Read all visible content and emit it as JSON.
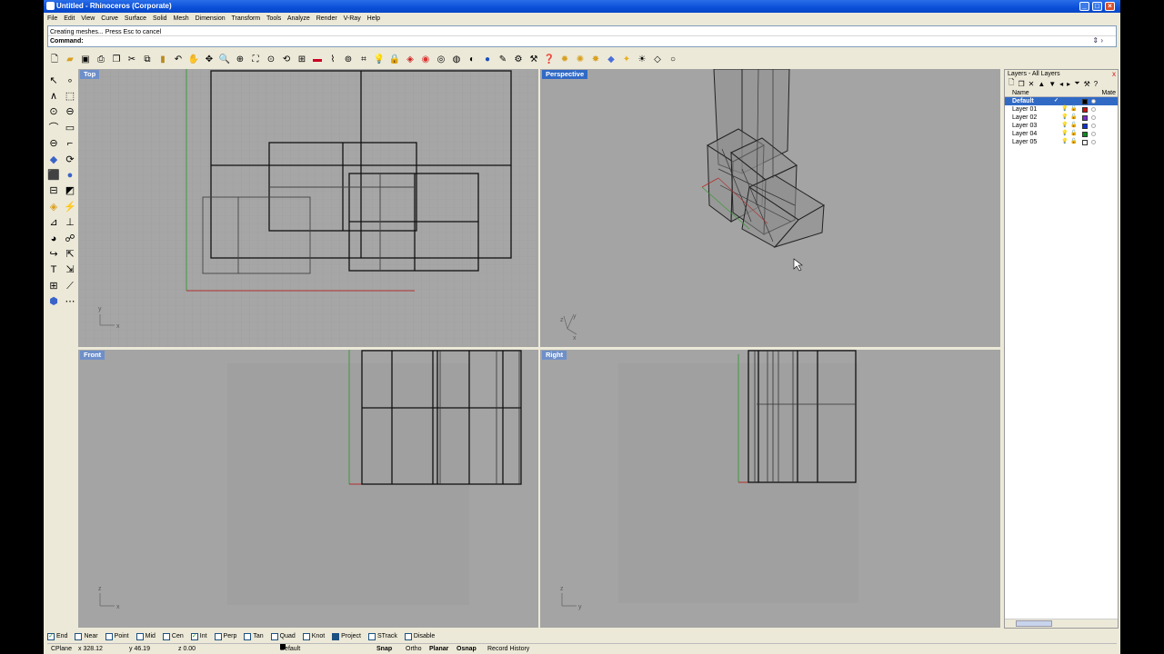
{
  "window": {
    "title": "Untitled - Rhinoceros (Corporate)"
  },
  "menu": [
    "File",
    "Edit",
    "View",
    "Curve",
    "Surface",
    "Solid",
    "Mesh",
    "Dimension",
    "Transform",
    "Tools",
    "Analyze",
    "Render",
    "V-Ray",
    "Help"
  ],
  "command": {
    "history": "Creating meshes... Press Esc to cancel",
    "prompt": "Command:"
  },
  "viewports": {
    "top": "Top",
    "perspective": "Perspective",
    "front": "Front",
    "right": "Right"
  },
  "axes": {
    "top_y": "y",
    "top_x": "x",
    "persp_z": "z",
    "persp_y": "y",
    "persp_x": "x",
    "front_z": "z",
    "front_x": "x",
    "right_z": "z",
    "right_y": "y"
  },
  "layers": {
    "title": "Layers - All Layers",
    "close": "x",
    "col_name": "Name",
    "col_material": "Mate",
    "items": [
      {
        "name": "Default",
        "color": "#000000",
        "current": "✓"
      },
      {
        "name": "Layer 01",
        "color": "#d01010"
      },
      {
        "name": "Layer 02",
        "color": "#7a2fd0"
      },
      {
        "name": "Layer 03",
        "color": "#1030d8"
      },
      {
        "name": "Layer 04",
        "color": "#108a20"
      },
      {
        "name": "Layer 05",
        "color": "#ffffff"
      }
    ]
  },
  "osnaps": [
    {
      "label": "End",
      "checked": true
    },
    {
      "label": "Near",
      "checked": false
    },
    {
      "label": "Point",
      "checked": false
    },
    {
      "label": "Mid",
      "checked": false
    },
    {
      "label": "Cen",
      "checked": false
    },
    {
      "label": "Int",
      "checked": true
    },
    {
      "label": "Perp",
      "checked": false
    },
    {
      "label": "Tan",
      "checked": false
    },
    {
      "label": "Quad",
      "checked": false
    },
    {
      "label": "Knot",
      "checked": false
    },
    {
      "label": "Project",
      "checked": true
    },
    {
      "label": "STrack",
      "checked": false
    },
    {
      "label": "Disable",
      "checked": false
    }
  ],
  "status": {
    "cplane": "CPlane",
    "x": "x 328.12",
    "y": "y 46.19",
    "z": "z 0.00",
    "layer": "Default",
    "snap": "Snap",
    "ortho": "Ortho",
    "planar": "Planar",
    "osnap": "Osnap",
    "record": "Record History"
  },
  "colors": {
    "viewport_bg": "#a4a4a4",
    "active_label": "#316ac5",
    "inactive_label": "#6e8fc9"
  }
}
